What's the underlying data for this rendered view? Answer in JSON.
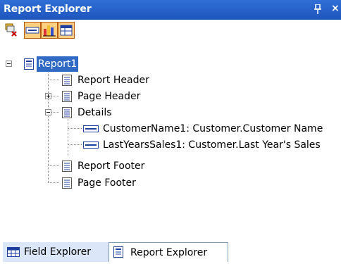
{
  "panel": {
    "title": "Report Explorer",
    "pin_glyph": "⊥",
    "close_glyph": "×"
  },
  "toolbar": {
    "buttons": [
      {
        "icon": "remove-icon",
        "active": false
      },
      {
        "icon": "field-icon",
        "active": true
      },
      {
        "icon": "chart-icon",
        "active": true
      },
      {
        "icon": "table-icon",
        "active": true
      }
    ]
  },
  "tree": {
    "root": {
      "label": "Report1",
      "selected": true,
      "expanded": true
    },
    "items": [
      {
        "label": "Report Header",
        "expander": "none"
      },
      {
        "label": "Page Header",
        "expander": "plus"
      },
      {
        "label": "Details",
        "expander": "minus"
      },
      {
        "label": "CustomerName1: Customer.Customer Name",
        "type": "field"
      },
      {
        "label": "LastYearsSales1: Customer.Last Year's Sales",
        "type": "field"
      },
      {
        "label": "Report Footer",
        "expander": "none"
      },
      {
        "label": "Page Footer",
        "expander": "none"
      }
    ]
  },
  "tabs": [
    {
      "label": "Field Explorer",
      "active": false,
      "icon": "field-explorer-icon"
    },
    {
      "label": "Report Explorer",
      "active": true,
      "icon": "report-explorer-icon"
    }
  ],
  "colors": {
    "titlebar": "#2f6fd6",
    "selection": "#316ac5",
    "toolbar_active": "#ffcf82"
  }
}
